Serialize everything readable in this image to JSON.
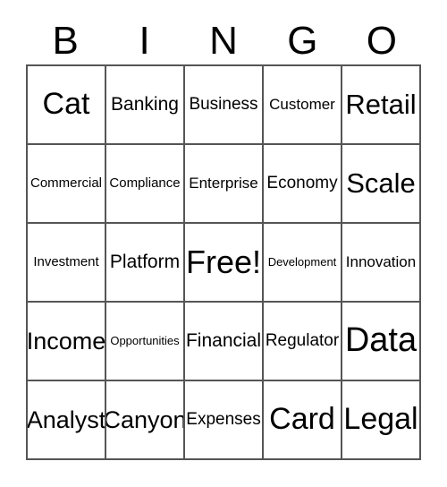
{
  "card": {
    "header": {
      "letters": [
        {
          "label": "B"
        },
        {
          "label": "I"
        },
        {
          "label": "N"
        },
        {
          "label": "G"
        },
        {
          "label": "O"
        }
      ]
    },
    "colors": {
      "background": "#ffffff",
      "text": "#000000",
      "border": "#555555"
    },
    "grid": {
      "columns": 5,
      "rows": 5,
      "free_space": {
        "row": 3,
        "column": 3,
        "label": "Free!"
      },
      "cells": [
        [
          {
            "label": "Cat",
            "size": "fs-4xl"
          },
          {
            "label": "Banking",
            "size": "fs-xl"
          },
          {
            "label": "Business",
            "size": "fs-lg"
          },
          {
            "label": "Customer",
            "size": "fs-md"
          },
          {
            "label": "Retail",
            "size": "fs-3xl"
          }
        ],
        [
          {
            "label": "Commercial",
            "size": "fs-sm"
          },
          {
            "label": "Compliance",
            "size": "fs-sm"
          },
          {
            "label": "Enterprise",
            "size": "fs-md"
          },
          {
            "label": "Economy",
            "size": "fs-lg"
          },
          {
            "label": "Scale",
            "size": "fs-3xl"
          }
        ],
        [
          {
            "label": "Investment",
            "size": "fs-sm"
          },
          {
            "label": "Platform",
            "size": "fs-xl"
          },
          {
            "label": "Free!",
            "size": "fs-5xl"
          },
          {
            "label": "Development",
            "size": "fs-xs"
          },
          {
            "label": "Innovation",
            "size": "fs-md"
          }
        ],
        [
          {
            "label": "Income",
            "size": "fs-2xl"
          },
          {
            "label": "Opportunities",
            "size": "fs-xs"
          },
          {
            "label": "Financial",
            "size": "fs-xl"
          },
          {
            "label": "Regulator",
            "size": "fs-lg"
          },
          {
            "label": "Data",
            "size": "fs-6xl"
          }
        ],
        [
          {
            "label": "Analyst",
            "size": "fs-2xl"
          },
          {
            "label": "Canyon",
            "size": "fs-2xl"
          },
          {
            "label": "Expenses",
            "size": "fs-lg"
          },
          {
            "label": "Card",
            "size": "fs-4xl"
          },
          {
            "label": "Legal",
            "size": "fs-4xl"
          }
        ]
      ]
    }
  }
}
